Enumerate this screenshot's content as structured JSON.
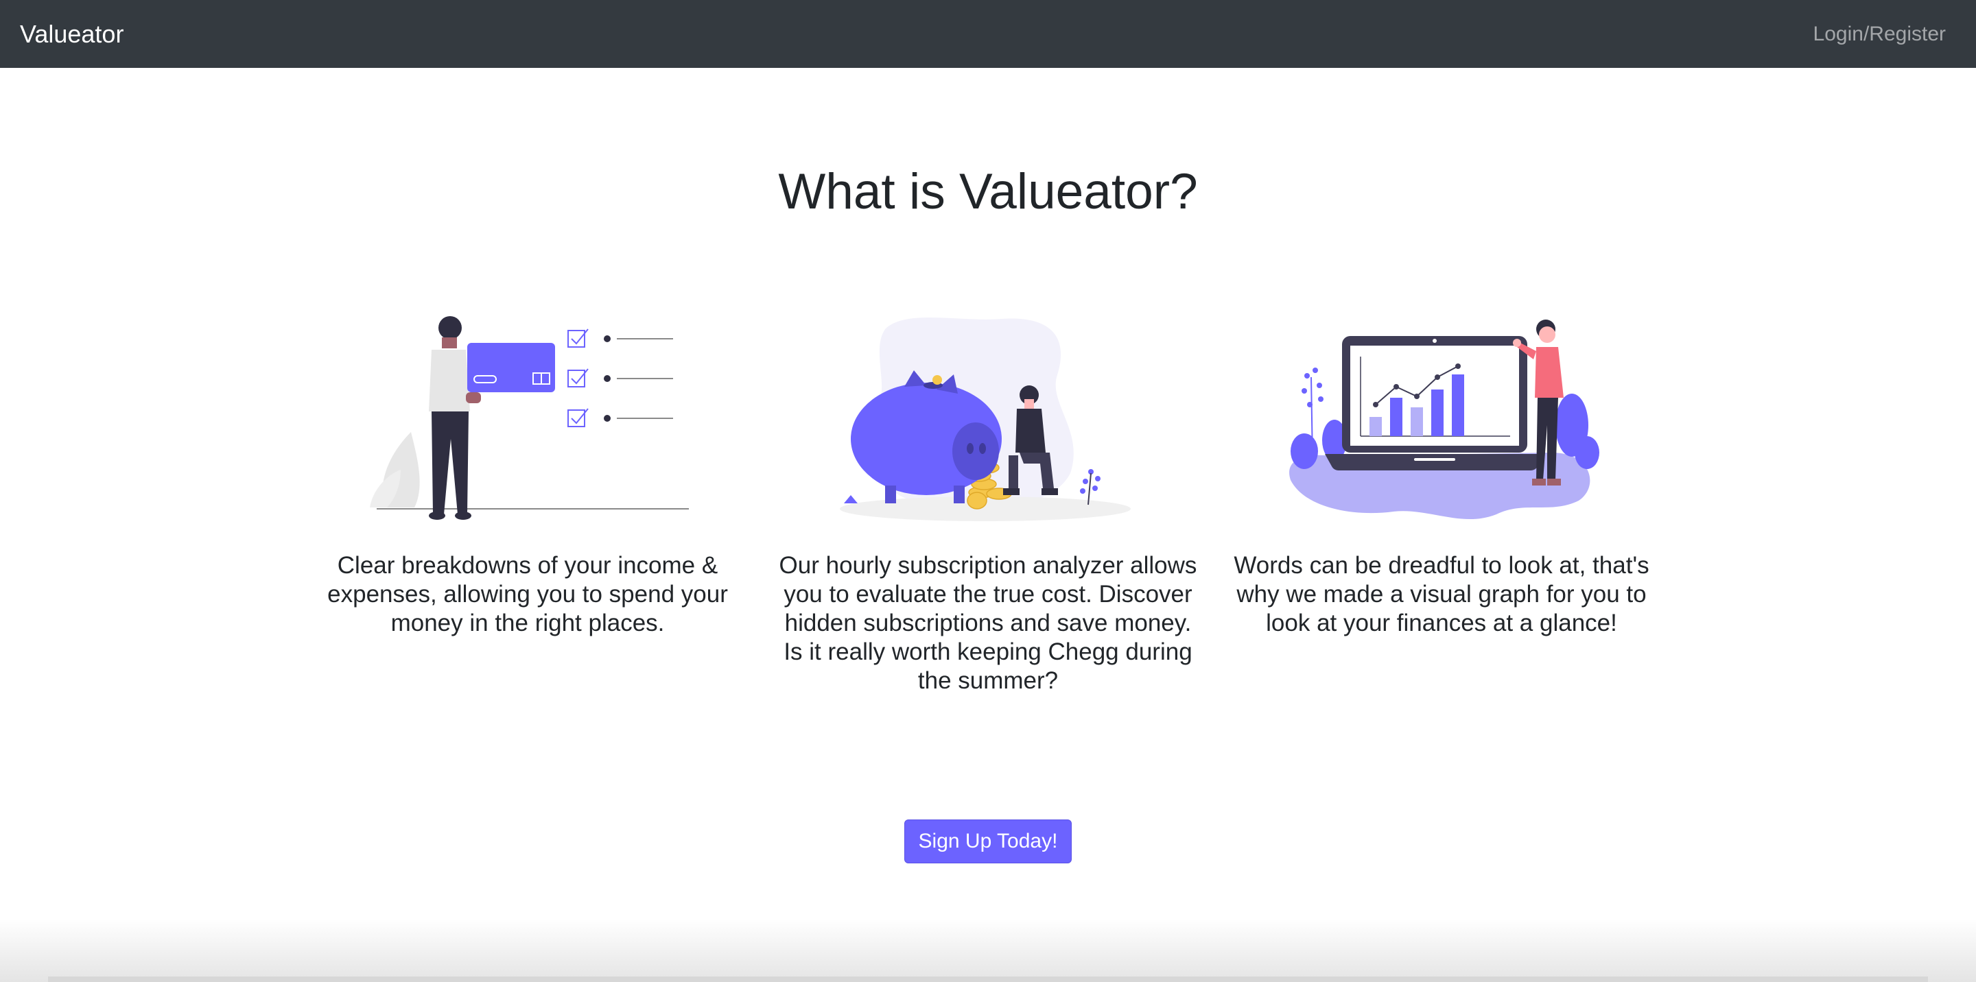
{
  "navbar": {
    "brand": "Valueator",
    "login_label": "Login/Register"
  },
  "main": {
    "title": "What is Valueator?",
    "features": [
      {
        "illustration": "person-holding-credit-card-checklist",
        "text": "Clear breakdowns of your income & expenses, allowing you to spend your money in the right places."
      },
      {
        "illustration": "piggy-bank-with-person-and-coins",
        "text": "Our hourly subscription analyzer allows you to evaluate the true cost. Discover hidden subscriptions and save money. Is it really worth keeping Chegg during the summer?"
      },
      {
        "illustration": "person-presenting-laptop-chart",
        "text": "Words can be dreadful to look at, that's why we made a visual graph for you to look at your finances at a glance!"
      }
    ],
    "cta_label": "Sign Up Today!"
  },
  "colors": {
    "navbar_bg": "#343a40",
    "accent": "#6c63ff",
    "accent_light": "#b4b0f8",
    "text": "#212529"
  }
}
